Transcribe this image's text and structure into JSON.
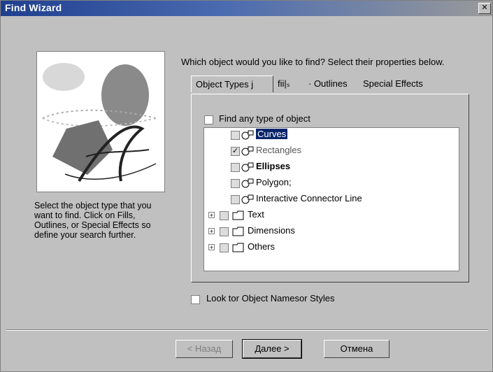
{
  "window": {
    "title": "Find Wizard",
    "close_glyph": "✕"
  },
  "left_panel": {
    "help_text": "Select the object type that you want to find. Click on Fills, Outlines, or Special Effects so define your search further."
  },
  "question": "Which object would you like to find? Select their properties below.",
  "tabs": [
    {
      "label": "Object Types j"
    },
    {
      "label": "fii|ₛ"
    },
    {
      "label": "· Outlines"
    },
    {
      "label": "Special Effects"
    }
  ],
  "find_any": {
    "label": "Find any type of object",
    "checked": false
  },
  "tree": [
    {
      "label": "Curves",
      "checked": false,
      "selected": true,
      "icon": "curve-object-icon"
    },
    {
      "label": "Rectangles",
      "checked": true,
      "icon": "rectangle-object-icon"
    },
    {
      "label": "Ellipses",
      "checked": false,
      "icon": "ellipse-object-icon"
    },
    {
      "label": "Polygon;",
      "checked": false,
      "icon": "polygon-object-icon"
    },
    {
      "label": "Interactive Connector Line",
      "checked": false,
      "icon": "connector-object-icon"
    },
    {
      "label": "Text",
      "checked": false,
      "icon": "folder-icon",
      "expandable": true
    },
    {
      "label": "Dimensions",
      "checked": false,
      "icon": "folder-icon",
      "expandable": true
    },
    {
      "label": "Others",
      "checked": false,
      "icon": "folder-icon",
      "expandable": true
    }
  ],
  "look_for_names": {
    "label": "Look tor Object Namesor Styles",
    "checked": false
  },
  "buttons": {
    "back": "< Назад",
    "next": "Далее >",
    "cancel": "Отмена"
  },
  "colors": {
    "selection": "#0a246a",
    "title_bar": "#1f3f8f",
    "dialog_face": "#c0c0c0"
  }
}
